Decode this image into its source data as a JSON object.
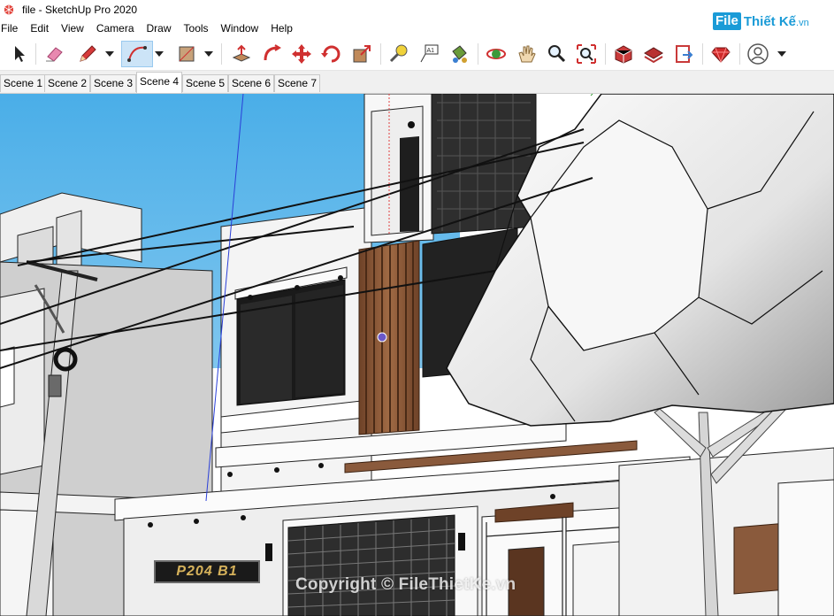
{
  "window": {
    "title": "file - SketchUp Pro 2020",
    "app_icon": "sketchup-icon"
  },
  "menu": {
    "items": [
      "File",
      "Edit",
      "View",
      "Camera",
      "Draw",
      "Tools",
      "Window",
      "Help"
    ]
  },
  "logo": {
    "badge": "File",
    "rest": "Thiết Kế",
    "suffix": ".vn"
  },
  "toolbar": {
    "tools": [
      {
        "name": "select-tool",
        "icon": "arrow-icon"
      },
      {
        "name": "eraser-tool",
        "icon": "eraser-icon"
      },
      {
        "name": "line-tool",
        "icon": "pencil-icon"
      },
      {
        "name": "arc-tool",
        "icon": "arc-icon",
        "active": true
      },
      {
        "name": "rectangle-tool",
        "icon": "rectangle-icon"
      },
      {
        "name": "push-pull-tool",
        "icon": "push-pull-icon"
      },
      {
        "name": "follow-me-tool",
        "icon": "follow-me-icon"
      },
      {
        "name": "move-tool",
        "icon": "move-icon"
      },
      {
        "name": "rotate-tool",
        "icon": "rotate-icon"
      },
      {
        "name": "scale-tool",
        "icon": "scale-icon"
      },
      {
        "name": "tape-measure-tool",
        "icon": "tape-measure-icon"
      },
      {
        "name": "text-tool",
        "icon": "text-icon",
        "label": "A1"
      },
      {
        "name": "paint-bucket-tool",
        "icon": "paint-bucket-icon"
      },
      {
        "name": "orbit-tool",
        "icon": "orbit-icon"
      },
      {
        "name": "pan-tool",
        "icon": "hand-icon"
      },
      {
        "name": "zoom-tool",
        "icon": "magnifier-icon"
      },
      {
        "name": "zoom-extents-tool",
        "icon": "zoom-extents-icon"
      },
      {
        "name": "3d-warehouse-button",
        "icon": "warehouse-icon"
      },
      {
        "name": "extension-warehouse-button",
        "icon": "extension-warehouse-icon"
      },
      {
        "name": "send-to-layout-button",
        "icon": "layout-icon"
      },
      {
        "name": "extension-manager-button",
        "icon": "ruby-icon"
      },
      {
        "name": "account-button",
        "icon": "user-icon"
      }
    ]
  },
  "scenes": {
    "tabs": [
      "Scene 1",
      "Scene 2",
      "Scene 3",
      "Scene 4",
      "Scene 5",
      "Scene 6",
      "Scene 7"
    ],
    "active_index": 3
  },
  "viewport": {
    "house_plate": "P204 B1",
    "watermark": "Copyright © FileThietKe.vn"
  },
  "colors": {
    "sky": "#5fb7ea",
    "wall": "#f2f2f2",
    "wood": "#8a5a3c",
    "accent": "#1a9bd7",
    "active_tool": "#cce4f7"
  }
}
